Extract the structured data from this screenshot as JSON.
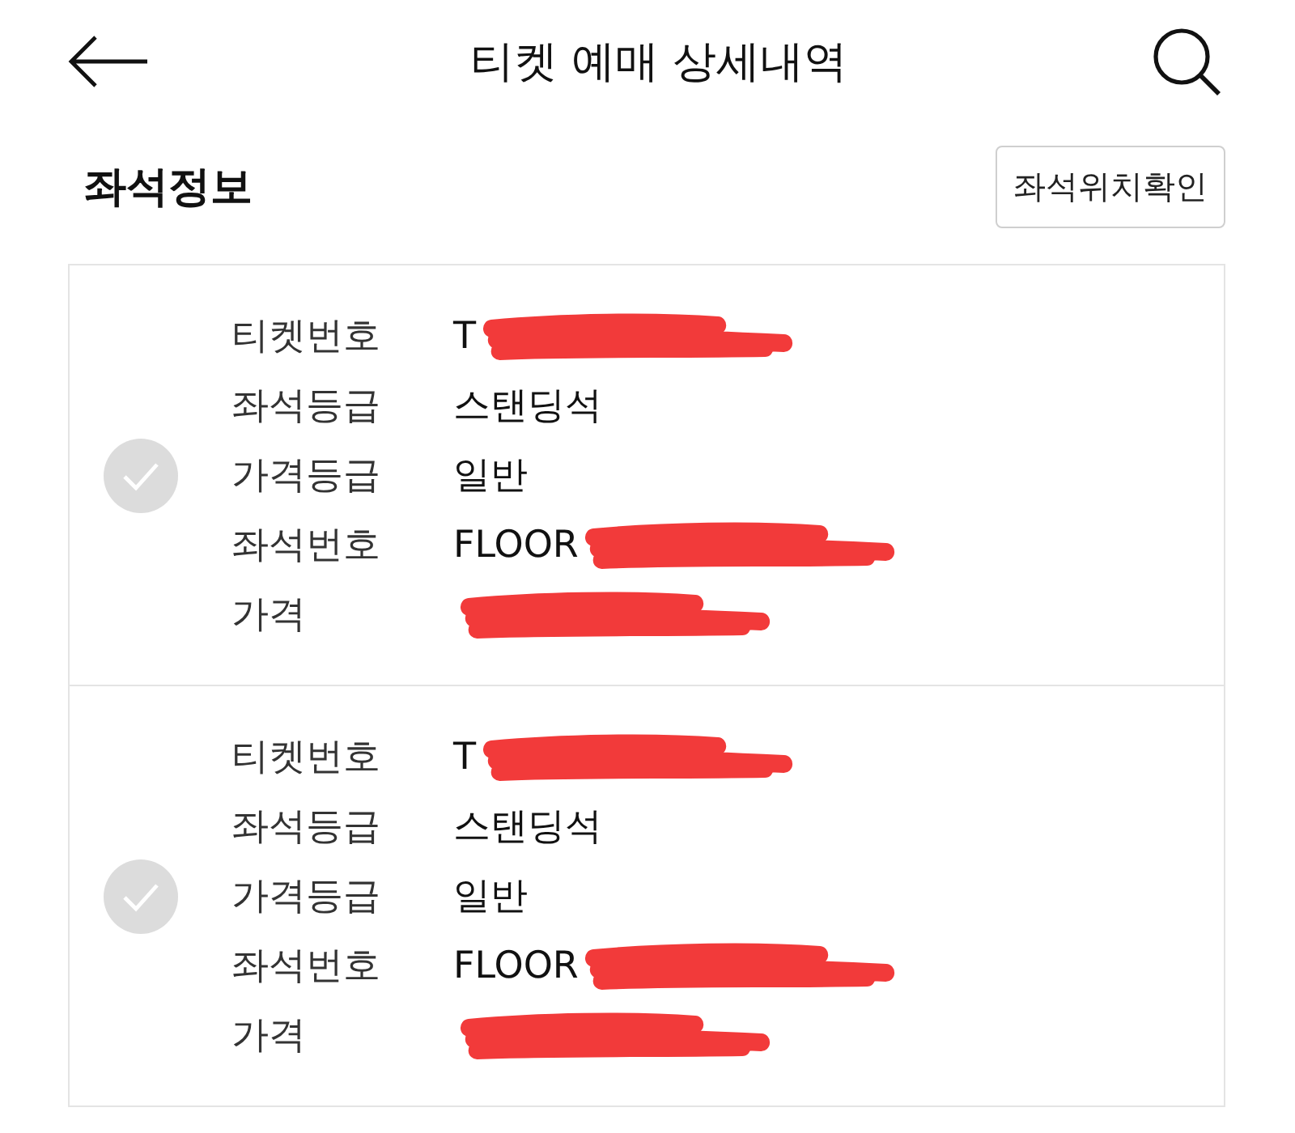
{
  "header": {
    "title": "티켓 예매 상세내역"
  },
  "section": {
    "title": "좌석정보",
    "button": "좌석위치확인"
  },
  "tickets": [
    {
      "selected": false,
      "fields": [
        {
          "label": "티켓번호",
          "value": "T",
          "redacted": true
        },
        {
          "label": "좌석등급",
          "value": "스탠딩석",
          "redacted": false
        },
        {
          "label": "가격등급",
          "value": "일반",
          "redacted": false
        },
        {
          "label": "좌석번호",
          "value": "FLOOR",
          "redacted": true
        },
        {
          "label": "가격",
          "redacted": true
        }
      ]
    },
    {
      "selected": false,
      "fields": [
        {
          "label": "티켓번호",
          "value": "T",
          "redacted": true
        },
        {
          "label": "좌석등급",
          "value": "스탠딩석",
          "redacted": false
        },
        {
          "label": "가격등급",
          "value": "일반",
          "redacted": false
        },
        {
          "label": "좌석번호",
          "value": "FLOOR",
          "redacted": true
        },
        {
          "label": "가격",
          "redacted": true
        }
      ]
    }
  ]
}
